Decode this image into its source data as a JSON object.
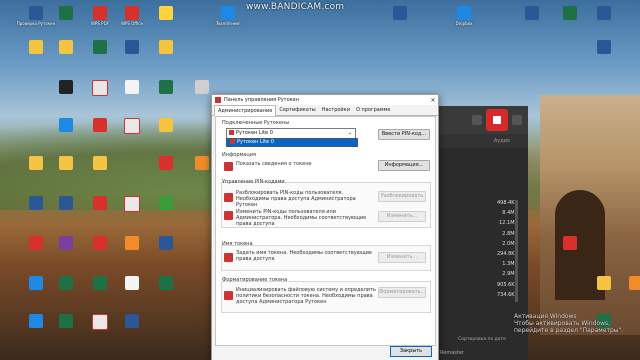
{
  "watermark": "www.BANDICAM.com",
  "activation": {
    "line1": "Активация Windows",
    "line2": "Чтобы активировать Windows, перейдите в раздел \"Параметры\"."
  },
  "desktop_icons": [
    {
      "label": "Проверка Рутокен",
      "color": "#2b5797"
    },
    {
      "label": "",
      "color": "#1e7145"
    },
    {
      "label": "WPS PDF",
      "color": "#d9302b"
    },
    {
      "label": "WPS Office",
      "color": "#d9302b"
    },
    {
      "label": "",
      "color": "#ffd23f"
    },
    {
      "label": "TeamViewer",
      "color": "#1e88e5"
    },
    {
      "label": "",
      "color": "#2b5797"
    },
    {
      "label": "Dropbox",
      "color": "#1e88e5"
    },
    {
      "label": "",
      "color": "#2b5797"
    },
    {
      "label": "",
      "color": "#1e7145"
    },
    {
      "label": "",
      "color": "#2b5797"
    },
    {
      "label": "",
      "color": "#2b5797"
    },
    {
      "label": "",
      "color": "#2b5797"
    },
    {
      "label": "",
      "color": "#1e7145"
    },
    {
      "label": "",
      "color": "#2b5797"
    }
  ],
  "bandicam": {
    "tab": "Аудио",
    "sizes": [
      "498.4KB",
      "8.4MB",
      "12.1MB",
      "2.8MB",
      "2.0MB",
      "294.8KB",
      "1.3MB",
      "2.9MB",
      "905.6KB",
      "734.6KB"
    ],
    "footer": "Сортировка по дате",
    "footer2": "Remaster"
  },
  "dialog": {
    "title": "Панель управления Рутокен",
    "tabs": [
      "Администрирование",
      "Сертификаты",
      "Настройки",
      "О программе"
    ],
    "active_tab": "Администрирование",
    "connected_label": "Подключенные Рутокены",
    "combo_value": "Рутокен Lite 0",
    "dropdown_item": "Рутокен Lite 0",
    "enter_pin_button": "Ввести PIN-код...",
    "info_group": "Информация",
    "info_text": "Показать сведения о токене",
    "info_button": "Информация...",
    "pin_group": "Управление PIN-кодами",
    "unlock_text": "Разблокировать PIN-коды пользователя. Необходимы права доступа Администратора Рутокен",
    "unlock_button": "Разблокировать",
    "change_text": "Изменить PIN-коды пользователя или Администратора. Необходимы соответствующие права доступа",
    "change_button": "Изменить...",
    "name_group": "Имя токена",
    "name_text": "Задать имя токена. Необходимы соответствующие права доступа",
    "name_button": "Изменить...",
    "format_group": "Форматирование токена",
    "format_text": "Инициализировать файловую систему и определить политики безопасности токена. Необходимы права доступа Администратора Рутокен",
    "format_button": "Форматировать...",
    "close_button": "Закрыть"
  }
}
